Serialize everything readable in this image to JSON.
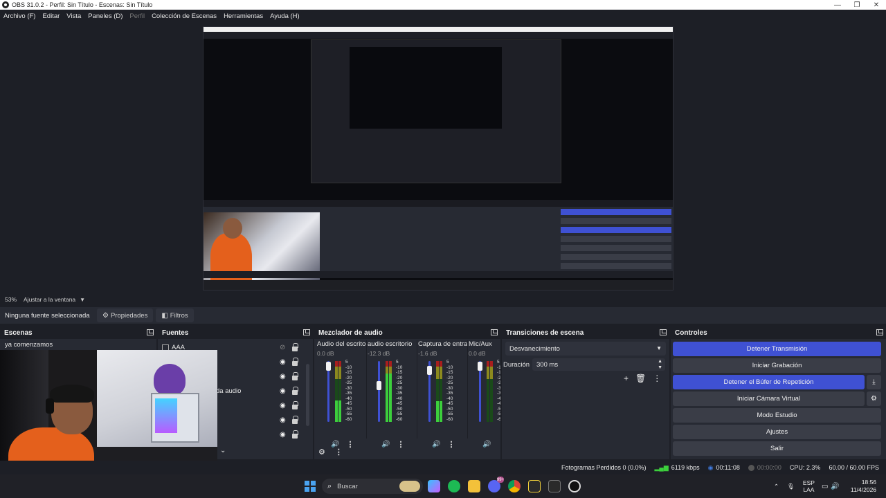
{
  "window": {
    "title": "OBS 31.0.2 - Perfil: Sin Título - Escenas: Sin Título",
    "controls": [
      "—",
      "❐",
      "✕"
    ]
  },
  "menu": {
    "items": [
      "Archivo (F)",
      "Editar",
      "Vista",
      "Paneles (D)",
      "Perfil",
      "Colección de Escenas",
      "Herramientas",
      "Ayuda (H)"
    ]
  },
  "zoom": {
    "percent": "53%",
    "mode": "Ajustar a la ventana"
  },
  "properties_bar": {
    "no_source": "Ninguna fuente seleccionada",
    "properties_label": "Propiedades",
    "filters_label": "Filtros"
  },
  "scenes": {
    "title": "Escenas",
    "items": [
      "ya comenzamos"
    ]
  },
  "sources": {
    "title": "Fuentes",
    "items": [
      "AAA",
      "",
      "",
      "da audio",
      "",
      "",
      ""
    ]
  },
  "mixer": {
    "title": "Mezclador de audio",
    "channels": [
      {
        "name": "Audio del escritorio",
        "db": "0.0 dB",
        "fader": 0.94,
        "level": 0.35
      },
      {
        "name": "audio escritorio",
        "db": "-12.3 dB",
        "fader": 0.62,
        "level": 0.8
      },
      {
        "name": "Captura de entrada",
        "db": "-1.6 dB",
        "fader": 0.88,
        "level": 0.34
      },
      {
        "name": "Mic/Aux",
        "db": "0.0 dB",
        "fader": 0.94,
        "level": 0.0
      }
    ],
    "scale": [
      "5",
      "-10",
      "-15",
      "-20",
      "-25",
      "-30",
      "-35",
      "-40",
      "-45",
      "-50",
      "-55",
      "-60"
    ]
  },
  "transitions": {
    "title": "Transiciones de escena",
    "selected": "Desvanecimiento",
    "duration_label": "Duración",
    "duration_value": "300 ms"
  },
  "controls": {
    "title": "Controles",
    "stop_stream": "Detener Transmisión",
    "start_recording": "Iniciar Grabación",
    "stop_replay": "Detener el Búfer de Repetición",
    "start_virtualcam": "Iniciar Cámara Virtual",
    "studio_mode": "Modo Estudio",
    "settings": "Ajustes",
    "exit": "Salir"
  },
  "status": {
    "dropped": "Fotogramas Perdidos 0 (0.0%)",
    "bitrate": "6119 kbps",
    "live_time": "00:11:08",
    "rec_time": "00:00:00",
    "cpu": "CPU: 2.3%",
    "fps": "60.00 / 60.00 FPS"
  },
  "taskbar": {
    "search_placeholder": "Buscar",
    "badge": "99+",
    "lang_top": "ESP",
    "lang_bottom": "LAA",
    "time": "18:56",
    "date": "11/4/2026"
  },
  "colors": {
    "accent_blue": "#3f51d3",
    "dock_bg": "#272a33",
    "meter_green": "#3ccf3c"
  }
}
